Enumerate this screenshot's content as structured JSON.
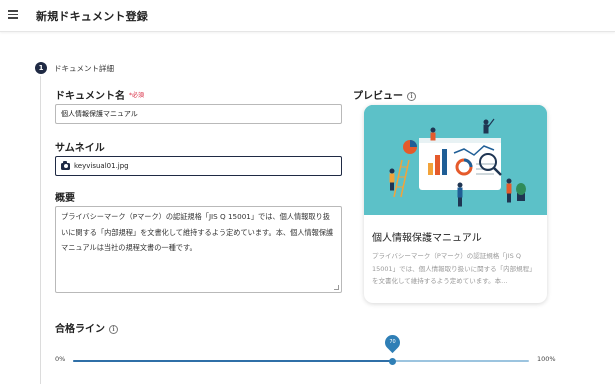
{
  "header": {
    "title": "新規ドキュメント登録",
    "menu_icon": "hamburger-menu-icon"
  },
  "step": {
    "number": "1",
    "label": "ドキュメント詳細"
  },
  "form": {
    "name_label": "ドキュメント名",
    "required_label": "*必須",
    "name_value": "個人情報保護マニュアル",
    "thumbnail_label": "サムネイル",
    "thumbnail_value": "keyvisual01.jpg",
    "thumbnail_icon": "camera-icon",
    "summary_label": "概要",
    "summary_value": "プライバシーマーク（Pマーク）の認証規格「JIS Q 15001」では、個人情報取り扱いに関する「内部規程」を文書化して維持するよう定めています。本、個人情報保護マニュアルは当社の規程文書の一種です。",
    "pass_line_label": "合格ライン",
    "info_icon": "info-icon"
  },
  "preview": {
    "label": "プレビュー",
    "card_title": "個人情報保護マニュアル",
    "card_desc": "プライバシーマーク（Pマーク）の認証規格「JIS Q 15001」では、個人情報取り扱いに関する「内部規程」を文書化して維持するよう定めています。本…"
  },
  "slider": {
    "min_label": "0%",
    "max_label": "100%",
    "value": 70,
    "value_label": "70"
  },
  "colors": {
    "primary": "#1f2a44",
    "accent": "#2f7fb6",
    "required": "#d7263d",
    "illustration_bg": "#5cc1c8"
  }
}
